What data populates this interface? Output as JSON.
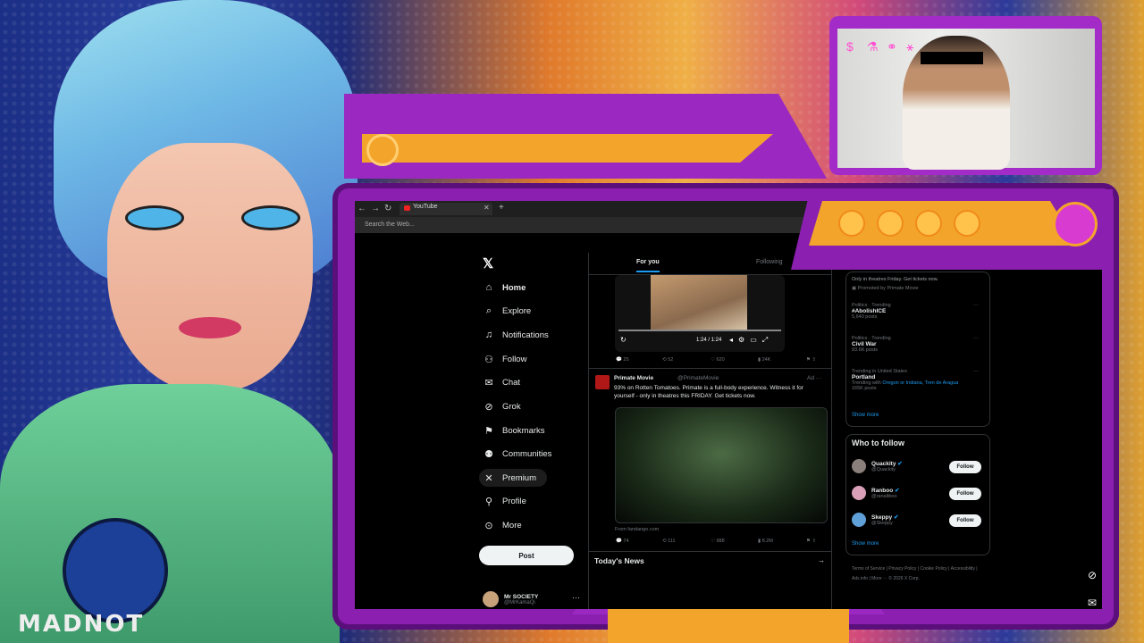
{
  "browser": {
    "tab_title": "YouTube",
    "search_placeholder": "Search the Web..."
  },
  "sidebar": {
    "items": [
      {
        "label": "Home",
        "icon": "home-icon"
      },
      {
        "label": "Explore",
        "icon": "search-icon"
      },
      {
        "label": "Notifications",
        "icon": "bell-icon"
      },
      {
        "label": "Follow",
        "icon": "add-user-icon"
      },
      {
        "label": "Chat",
        "icon": "mail-icon"
      },
      {
        "label": "Grok",
        "icon": "grok-icon"
      },
      {
        "label": "Bookmarks",
        "icon": "bookmark-icon"
      },
      {
        "label": "Communities",
        "icon": "people-icon"
      },
      {
        "label": "Premium",
        "icon": "x-icon"
      },
      {
        "label": "Profile",
        "icon": "user-icon"
      },
      {
        "label": "More",
        "icon": "more-icon"
      }
    ],
    "post_label": "Post",
    "account": {
      "name": "Mr SOCIETY",
      "handle": "@MrKamaQi"
    }
  },
  "feed": {
    "tabs": [
      "For you",
      "Following"
    ],
    "video1": {
      "time": "1:24 / 1:24",
      "stats": [
        "25",
        "52",
        "620",
        "24K"
      ]
    },
    "ad": {
      "name": "Primate Movie",
      "handle": "@PrimateMovie",
      "tag": "Ad",
      "text": "93% on Rotten Tomatoes. Primate is a full-body experience. Witness it for yourself - only in theatres this FRIDAY. Get tickets now.",
      "from": "From fandango.com",
      "stats": [
        "74",
        "111",
        "988",
        "8.2M"
      ]
    },
    "news_title": "Today's News"
  },
  "trends": {
    "promo_text": "Only in theatres Friday. Get tickets now.",
    "promo_by": "Promoted by Primate Movie",
    "items": [
      {
        "context": "Politics · Trending",
        "title": "#AbolishICE",
        "count": "5,640 posts"
      },
      {
        "context": "Politics · Trending",
        "title": "Civil War",
        "count": "93.6K posts"
      },
      {
        "context": "Trending in United States",
        "title": "Portland",
        "count": "165K posts",
        "related_prefix": "Trending with",
        "related": "Oregon or Indiana, Tren de Aragua"
      }
    ],
    "show_more": "Show more"
  },
  "who_to_follow": {
    "title": "Who to follow",
    "users": [
      {
        "name": "Quackity",
        "handle": "@Quackity",
        "button": "Follow",
        "color": "#8a7f7a"
      },
      {
        "name": "Ranboo",
        "handle": "@ranaltboo",
        "button": "Follow",
        "color": "#d9a0b8"
      },
      {
        "name": "Skeppy",
        "handle": "@Skeppy",
        "button": "Follow",
        "color": "#5fa0d8"
      }
    ],
    "show_more": "Show more"
  },
  "footer": {
    "links": "Terms of Service  |  Privacy Policy  |  Cookie Policy  |  Accessibility  |  Ads info  |  More ···  © 2026 X Corp."
  },
  "overlay": {
    "poster_text": "MADNOT"
  },
  "colors": {
    "accent": "#1d9bf0",
    "frame_purple": "#8b1fb0",
    "frame_orange": "#f3a52b"
  }
}
